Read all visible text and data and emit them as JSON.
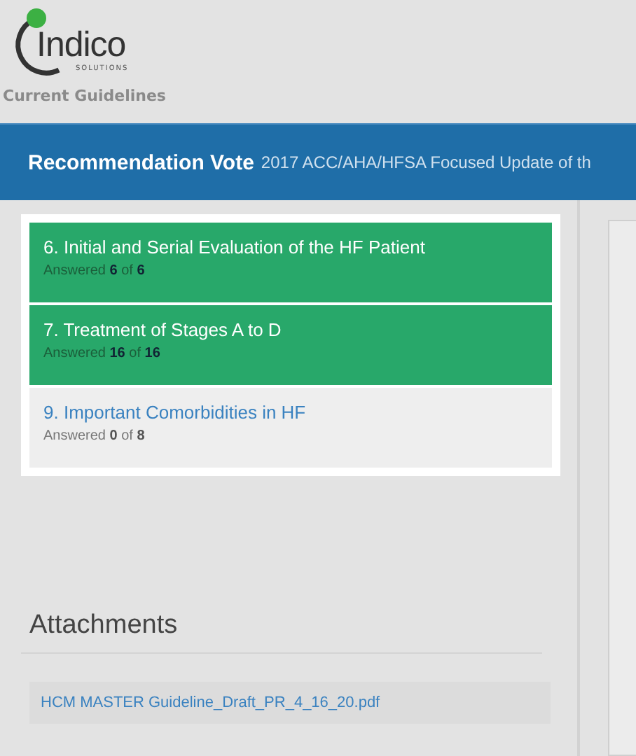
{
  "logo": {
    "name": "Indico",
    "tagline": "SOLUTIONS"
  },
  "breadcrumb": "Current Guidelines",
  "banner": {
    "title": "Recommendation Vote",
    "subtitle": "2017 ACC/AHA/HFSA Focused Update of th"
  },
  "sections": [
    {
      "title": "6. Initial and Serial Evaluation of the HF Patient",
      "progress": "Answered **6** of **6**",
      "complete": true
    },
    {
      "title": "7. Treatment of Stages A to D",
      "progress": "Answered **16** of **16**",
      "complete": true
    },
    {
      "title": "9. Important Comorbidities in HF",
      "progress": "Answered **0** of **8**",
      "complete": false
    }
  ],
  "attachments": {
    "heading": "Attachments",
    "files": [
      "HCM MASTER Guideline_Draft_PR_4_16_20.pdf"
    ]
  }
}
